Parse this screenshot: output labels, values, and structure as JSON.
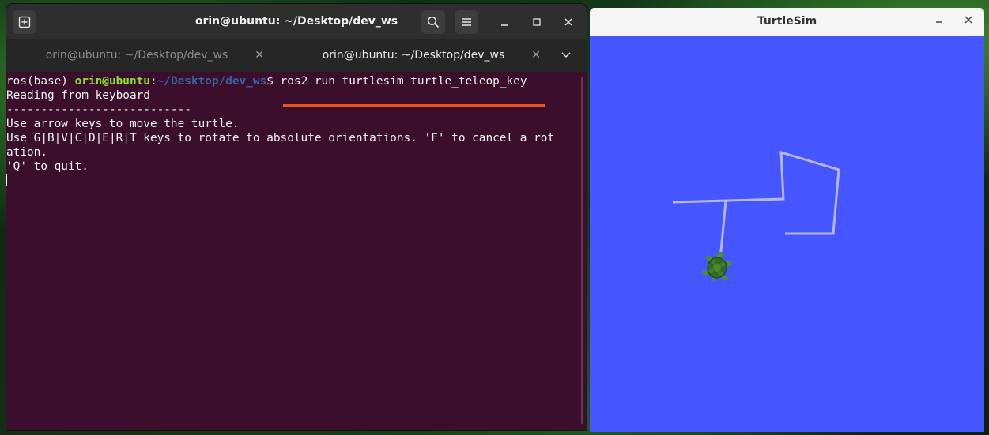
{
  "terminal": {
    "title": "orin@ubuntu: ~/Desktop/dev_ws",
    "tabs": [
      {
        "label": "orin@ubuntu: ~/Desktop/dev_ws",
        "active": false
      },
      {
        "label": "orin@ubuntu: ~/Desktop/dev_ws",
        "active": true
      }
    ],
    "prompt": {
      "env": "ros(base) ",
      "user": "orin@ubuntu",
      "sep": ":",
      "path": "~/Desktop/dev_ws",
      "symbol": "$ ",
      "command": "ros2 run turtlesim turtle_teleop_key"
    },
    "output": [
      "Reading from keyboard",
      "---------------------------",
      "Use arrow keys to move the turtle.",
      "Use G|B|V|C|D|E|R|T keys to rotate to absolute orientations. 'F' to cancel a rot",
      "ation.",
      "'Q' to quit."
    ],
    "colors": {
      "background": "#3b0f2c",
      "accent": "#e95420",
      "user": "#8ae234",
      "path": "#3465a4"
    }
  },
  "turtlesim": {
    "title": "TurtleSim",
    "background_color": "#4556ff",
    "trail_color": "#b3b8e8"
  },
  "icons": {
    "new_tab": "new-tab-icon",
    "search": "search-icon",
    "menu": "hamburger-menu-icon",
    "minimize": "minimize-icon",
    "maximize": "maximize-icon",
    "close": "close-icon",
    "tab_dropdown": "chevron-down-icon",
    "turtle": "turtle-icon"
  }
}
